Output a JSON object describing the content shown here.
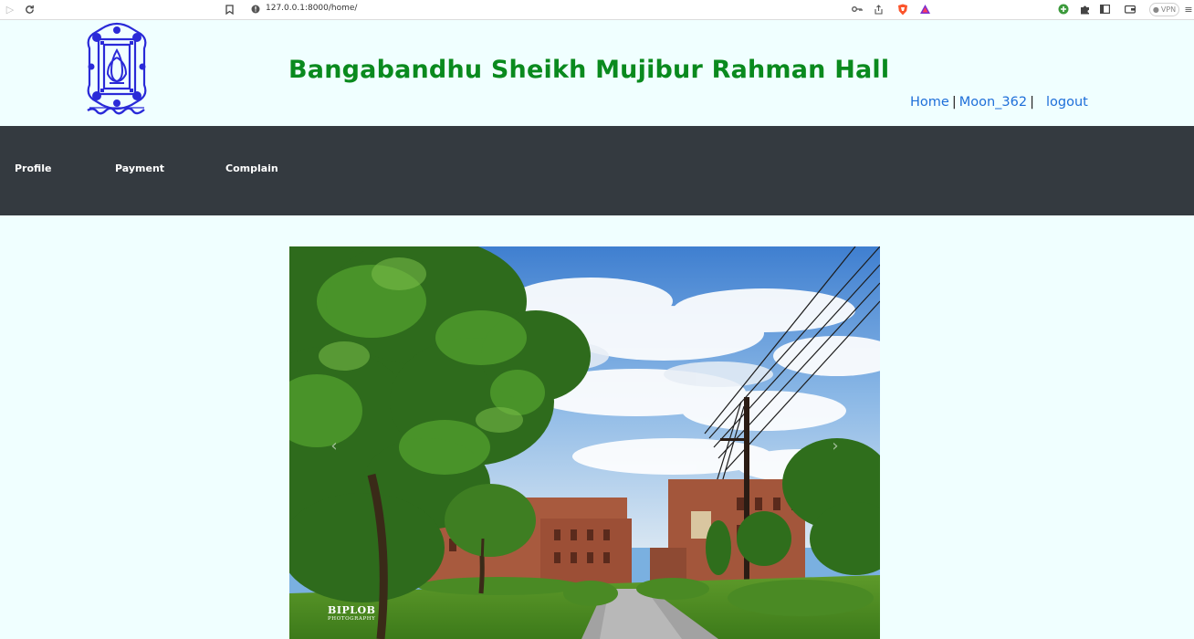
{
  "browser": {
    "url": "127.0.0.1:8000/home/",
    "vpn_label": "VPN"
  },
  "header": {
    "title": "Bangabandhu Sheikh Mujibur Rahman Hall",
    "nav": {
      "home": "Home",
      "separator": "|",
      "user": "Moon_362",
      "logout": "logout"
    }
  },
  "navbar": {
    "items": [
      {
        "label": "Profile"
      },
      {
        "label": "Payment"
      },
      {
        "label": "Complain"
      }
    ]
  },
  "carousel": {
    "watermark_line1": "BIPLOB",
    "watermark_line2": "PHOTOGRAPHY",
    "prev_icon": "chevron-left-icon",
    "next_icon": "chevron-right-icon"
  },
  "colors": {
    "title_green": "#0a8a1e",
    "link_blue": "#1e6fd9",
    "navbar_bg": "#343a40",
    "page_bg": "#f0ffff",
    "logo_blue": "#2a2ad8"
  }
}
